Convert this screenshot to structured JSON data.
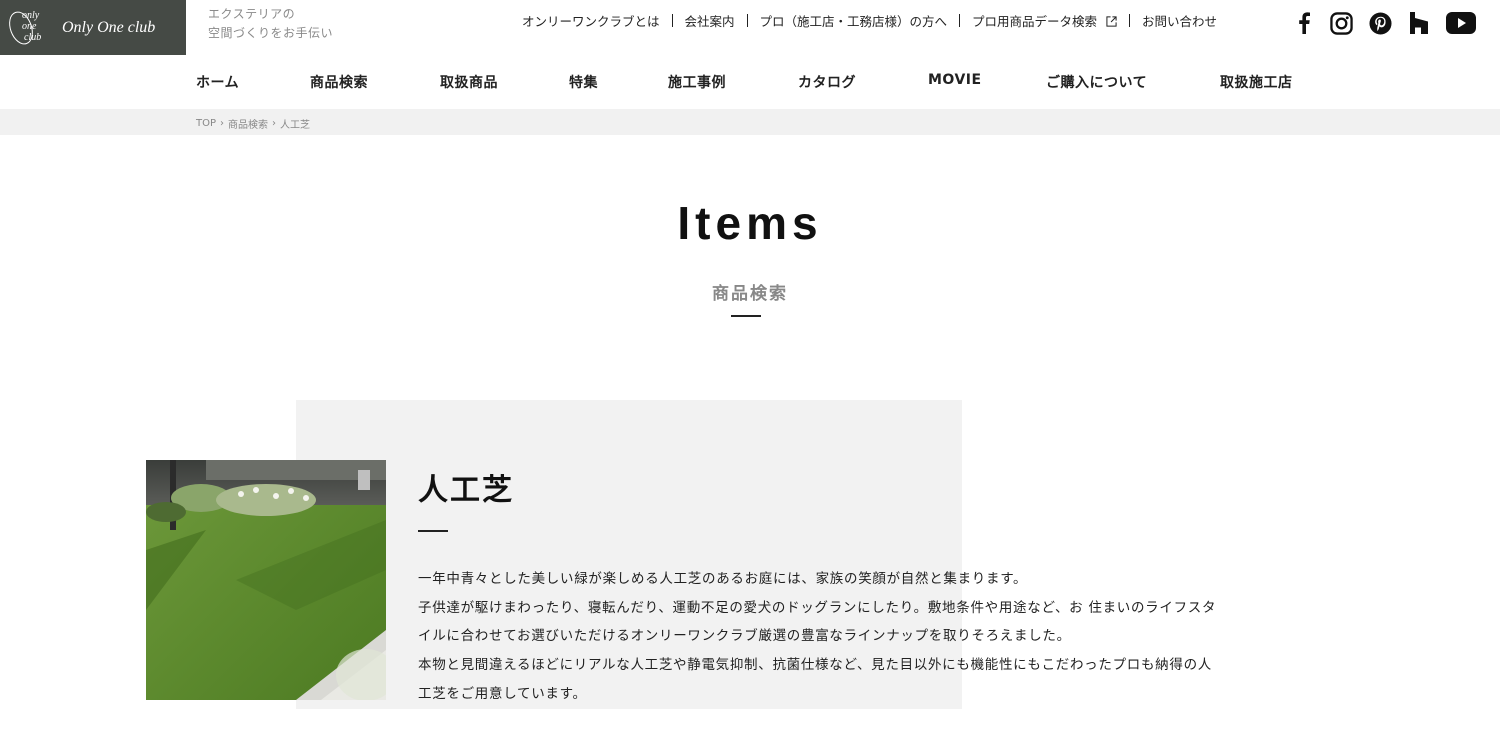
{
  "header": {
    "logo": {
      "mark_words": [
        "only",
        "one",
        "club"
      ],
      "text": "Only One club"
    },
    "tagline_lines": [
      "エクステリアの",
      "空間づくりをお手伝い"
    ],
    "util_nav": [
      {
        "label": "オンリーワンクラブとは"
      },
      {
        "label": "会社案内"
      },
      {
        "label": "プロ（施工店・工務店様）の方へ"
      },
      {
        "label": "プロ用商品データ検索",
        "external": true
      },
      {
        "label": "お問い合わせ"
      }
    ],
    "social_icons": [
      "facebook-icon",
      "instagram-icon",
      "pinterest-icon",
      "houzz-icon",
      "youtube-icon"
    ]
  },
  "main_nav": [
    {
      "label": "ホーム"
    },
    {
      "label": "商品検索"
    },
    {
      "label": "取扱商品"
    },
    {
      "label": "特集"
    },
    {
      "label": "施工事例"
    },
    {
      "label": "カタログ"
    },
    {
      "label": "MOVIE"
    },
    {
      "label": "ご購入について"
    },
    {
      "label": "取扱施工店"
    }
  ],
  "breadcrumb": [
    "TOP",
    "商品検索",
    "人工芝"
  ],
  "page": {
    "title": "Items",
    "subtitle": "商品検索"
  },
  "category": {
    "title": "人工芝",
    "body_lines": [
      "一年中青々とした美しい緑が楽しめる人工芝のあるお庭には、家族の笑顔が自然と集まります。",
      "子供達が駆けまわったり、寝転んだり、運動不足の愛犬のドッグランにしたり。敷地条件や用途など、お 住まいのライフスタ",
      "イルに合わせてお選びいただけるオンリーワンクラブ厳選の豊富なラインナップを取りそろえました。",
      "本物と見間違えるほどにリアルな人工芝や静電気抑制、抗菌仕様など、見た目以外にも機能性にもこだわったプロも納得の人",
      "工芝をご用意しています。"
    ]
  },
  "colors": {
    "logo_bg": "#454a45",
    "breadcrumb_bg": "#f1f1f1",
    "panel_bg": "#f2f2f2",
    "text": "#222222",
    "muted": "#888888"
  }
}
